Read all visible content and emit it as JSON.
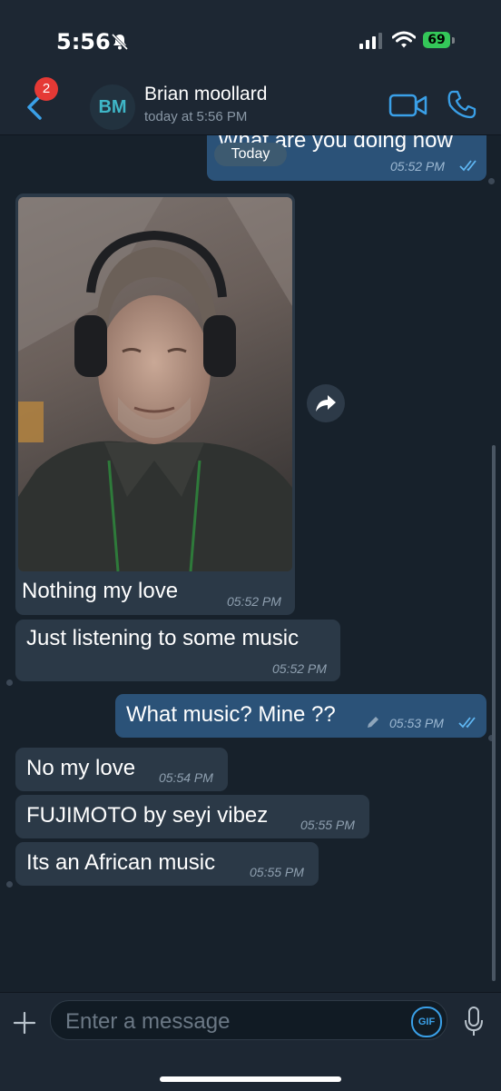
{
  "status_bar": {
    "time": "5:56",
    "battery": "69"
  },
  "header": {
    "back_badge": "2",
    "avatar_initials": "BM",
    "contact_name": "Brian moollard",
    "contact_status": "today at 5:56 PM"
  },
  "chat": {
    "date_chip": "Today",
    "messages": [
      {
        "direction": "out",
        "text": "What are you doing now",
        "time": "05:52 PM",
        "read": true
      },
      {
        "direction": "in",
        "text": "Nothing my love",
        "time": "05:52 PM",
        "has_photo": true
      },
      {
        "direction": "in",
        "text": "Just listening to some music",
        "time": "05:52 PM"
      },
      {
        "direction": "out",
        "text": "What music? Mine ??",
        "time": "05:53 PM",
        "edited": true,
        "read": true
      },
      {
        "direction": "in",
        "text": "No my love",
        "time": "05:54 PM"
      },
      {
        "direction": "in",
        "text": "FUJIMOTO by seyi vibez",
        "time": "05:55 PM"
      },
      {
        "direction": "in",
        "text": "Its an African music",
        "time": "05:55 PM"
      }
    ]
  },
  "composer": {
    "placeholder": "Enter a message",
    "gif_label": "GIF"
  },
  "colors": {
    "background": "#17212b",
    "incoming_bubble": "#2b3947",
    "outgoing_bubble": "#2b5278",
    "accent": "#3aa0e8"
  },
  "icons": [
    "bell-slash-icon",
    "signal-icon",
    "wifi-icon",
    "back-chevron-icon",
    "video-call-icon",
    "phone-icon",
    "share-icon",
    "pencil-icon",
    "double-check-icon",
    "plus-icon",
    "mic-icon"
  ]
}
